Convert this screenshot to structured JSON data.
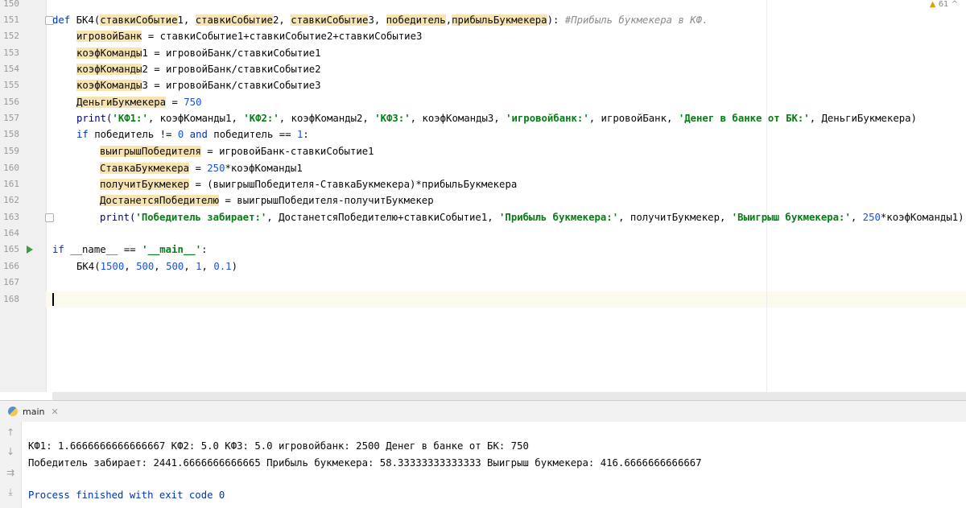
{
  "editor": {
    "line_numbers": [
      "150",
      "151",
      "152",
      "153",
      "154",
      "155",
      "156",
      "157",
      "158",
      "159",
      "160",
      "161",
      "162",
      "163",
      "164",
      "165",
      "166",
      "167",
      "168"
    ],
    "warnings_count": "61",
    "code": {
      "l151": {
        "def": "def",
        "fn": "БК4(",
        "p1": "ставкиСобытие",
        "p1n": "1",
        "c1": ", ",
        "p2": "ставкиСобытие",
        "p2n": "2",
        "c2": ", ",
        "p3": "ставкиСобытие",
        "p3n": "3",
        "c3": ", ",
        "p4": "победитель",
        "c4": ",",
        "p5": "прибыльБукмекера",
        "close": "): ",
        "comment": "#Прибыль букмекера в КФ."
      },
      "l152": {
        "var": "игровойБанк",
        "rest": " = ставкиСобытие1+ставкиСобытие2+ставкиСобытие3"
      },
      "l153": {
        "var": "коэфКоманды",
        "varn": "1",
        "rest": " = игровойБанк/ставкиСобытие1"
      },
      "l154": {
        "var": "коэфКоманды",
        "varn": "2",
        "rest": " = игровойБанк/ставкиСобытие2"
      },
      "l155": {
        "var": "коэфКоманды",
        "varn": "3",
        "rest": " = игровойБанк/ставкиСобытие3"
      },
      "l156": {
        "var": "ДеньгиБукмекера",
        "eq": " = ",
        "num": "750"
      },
      "l157": {
        "print": "print(",
        "s1": "'КФ1:'",
        "a1": ", коэфКоманды1, ",
        "s2": "'КФ2:'",
        "a2": ", коэфКоманды2, ",
        "s3": "'КФ3:'",
        "a3": ", коэфКоманды3, ",
        "s4": "'игровойбанк:'",
        "a4": ", игровойБанк, ",
        "s5": "'Денег в банке от БК:'",
        "a5": ", ДеньгиБукмекера)"
      },
      "l158": {
        "if": "if",
        "a": " победитель != ",
        "n0": "0",
        "and": " and",
        "b": " победитель == ",
        "n1": "1",
        "c": ":"
      },
      "l159": {
        "var": "выигрышПобедителя",
        "rest": " = игровойБанк-ставкиСобытие1"
      },
      "l160": {
        "var": "СтавкаБукмекера",
        "eq": " = ",
        "num": "250",
        "rest": "*коэфКоманды1"
      },
      "l161": {
        "var": "получитБукмекер",
        "rest": " = (выигрышПобедителя-СтавкаБукмекера)*прибыльБукмекера"
      },
      "l162": {
        "var": "ДостанетсяПобедителю",
        "rest": " = выигрышПобедителя-получитБукмекер"
      },
      "l163": {
        "print": "print(",
        "s1": "'Победитель забирает:'",
        "a1": ", ДостанетсяПобедителю+ставкиСобытие1, ",
        "s2": "'Прибыль букмекера:'",
        "a2": ", получитБукмекер, ",
        "s3": "'Выигрыш букмекера:'",
        "a3": ", ",
        "num": "250",
        "a4": "*коэфКоманды1)"
      },
      "l165": {
        "if": "if",
        "a": " __name__ == ",
        "s": "'__main__'",
        "c": ":"
      },
      "l166": {
        "fn": "БК4(",
        "n1": "1500",
        "c1": ", ",
        "n2": "500",
        "c2": ", ",
        "n3": "500",
        "c3": ", ",
        "n4": "1",
        "c4": ", ",
        "n5": "0.1",
        "close": ")"
      }
    }
  },
  "run_panel": {
    "tab_label": "main",
    "output": [
      "КФ1: 1.6666666666666667 КФ2: 5.0 КФ3: 5.0 игровойбанк: 2500 Денег в банке от БК: 750",
      "Победитель забирает: 2441.6666666666665 Прибыль букмекера: 58.33333333333333 Выигрыш букмекера: 416.6666666666667",
      "",
      "Process finished with exit code 0"
    ]
  }
}
